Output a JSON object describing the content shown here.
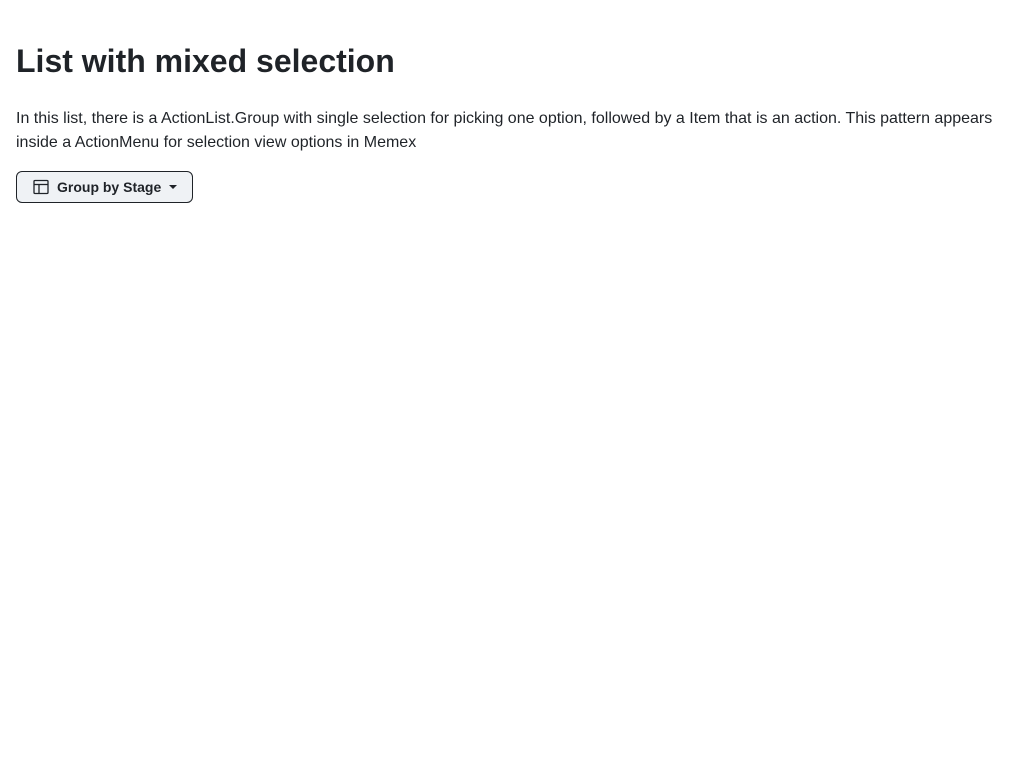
{
  "page": {
    "title": "List with mixed selection",
    "description": "In this list, there is a ActionList.Group with single selection for picking one option, followed by a Item that is an action. This pattern appears inside a ActionMenu for selection view options in Memex"
  },
  "menu_button": {
    "label": "Group by Stage",
    "icon": "table-icon"
  }
}
